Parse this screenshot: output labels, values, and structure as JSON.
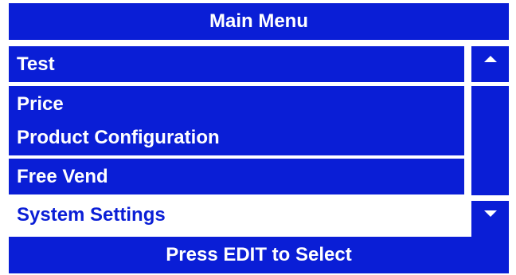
{
  "header": {
    "title": "Main Menu"
  },
  "menu": {
    "items": [
      {
        "label": "Test",
        "selected": false
      },
      {
        "label": "Price",
        "selected": false
      },
      {
        "label": "Product Configuration",
        "selected": false
      },
      {
        "label": "Free Vend",
        "selected": false
      },
      {
        "label": "System Settings",
        "selected": true
      }
    ]
  },
  "scrollbar": {
    "up_icon": "triangle-up",
    "down_icon": "triangle-down"
  },
  "footer": {
    "instruction": "Press EDIT to Select"
  },
  "colors": {
    "accent": "#0a1ed6",
    "text_on_accent": "#ffffff",
    "selected_bg": "#ffffff"
  }
}
